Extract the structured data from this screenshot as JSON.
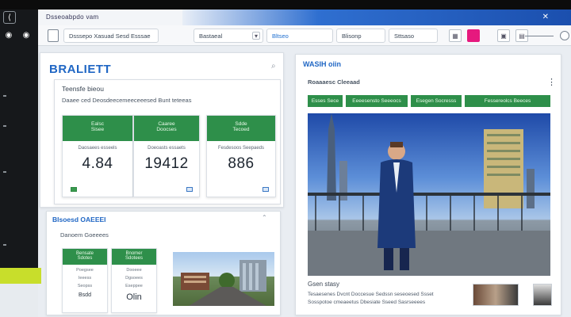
{
  "window": {
    "title": "Dsseoabpdo vam",
    "close_glyph": "✕"
  },
  "toolbar": {
    "breadcrumb": "Dsssepo Xasuad Sesd Esssae",
    "select_value": "Bastaeal",
    "search_value": "Bltseo",
    "location_label": "Blisonp",
    "field_value": "Sttsaso"
  },
  "brand": "BRALIETT",
  "dashboard": {
    "title": "Teensfe bieou",
    "subtitle": "Daaee ced Deosdeecemeeceeesed Bunt teteeas",
    "cards": [
      {
        "head1": "Ealsc",
        "head2": "Sisee",
        "label": "Daosaees esseels",
        "value": "4.84"
      },
      {
        "head1": "Caaree",
        "head2": "Doocses",
        "label": "Doeoasts essaets",
        "value": "19412"
      },
      {
        "head1": "Sdde",
        "head2": "Tecoed",
        "label": "Fesdesoos Seepaeds",
        "value": "886"
      }
    ]
  },
  "lower": {
    "title": "Blsoesd OAEEEI",
    "subtitle": "Danoem Goeeees",
    "cards": [
      {
        "head1": "Bensate",
        "head2": "Sdotes",
        "line1": "Poegsee",
        "line2": "Ieeess",
        "line3": "Seopss",
        "value": "Bsdd"
      },
      {
        "head1": "Bnomer",
        "head2": "Sdotees",
        "line1": "Dooeee",
        "line2": "Dgsoees",
        "line3": "Eseppee",
        "value": "Olin"
      }
    ]
  },
  "feature": {
    "title": "WASIH oiin",
    "subtitle": "Roaaaesc Cleeaad",
    "tabs": [
      "Esses Sece",
      "Eeeesensto Seeeocs",
      "Esegen Socresss",
      "Fessereolcs Beeces"
    ],
    "caption_title": "Gsen stasy",
    "caption_lines": [
      "Tesaesenes Dvcnt Doccesue Sedssn seseoesed Ssset",
      "Sosspotoe cmeaeetus Dbesiate Sseed Sasrseeees"
    ],
    "more_glyph": "⋮"
  },
  "colors": {
    "accent_green": "#2e8f4a",
    "brand_blue": "#1f66c4",
    "rail": "#16181b",
    "lime": "#c8de2b"
  }
}
